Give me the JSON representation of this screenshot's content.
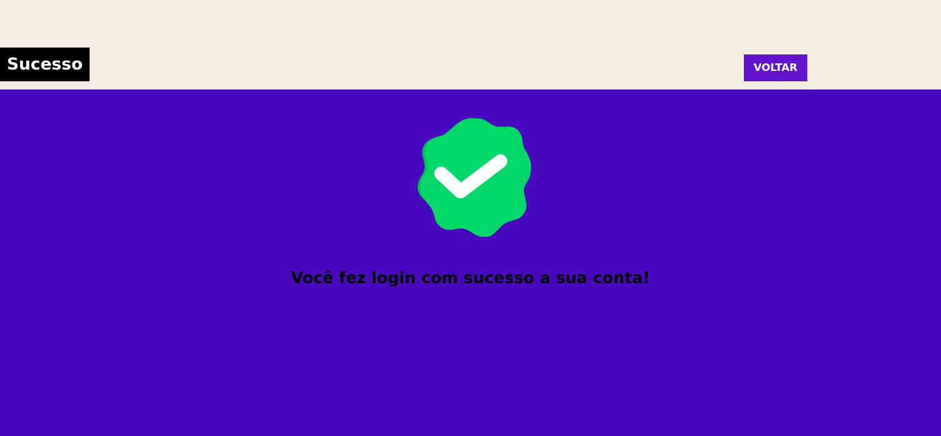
{
  "header": {
    "title": "Sucesso",
    "back_label": "VOLTAR"
  },
  "main": {
    "icon": "verified-check-badge-icon",
    "message": "Você fez login com sucesso a sua conta!"
  },
  "colors": {
    "header_background": "#f5ece0",
    "main_background": "#4a08be",
    "title_background": "#000000",
    "button_background": "#6414cc",
    "badge_green": "#00d868",
    "badge_shadow": "#00c05c",
    "check_white": "#ffffff"
  }
}
